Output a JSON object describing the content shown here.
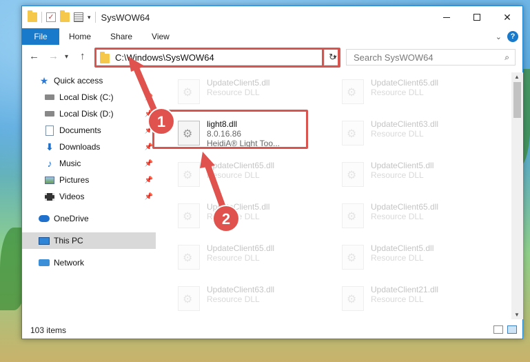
{
  "window": {
    "title": "SysWOW64"
  },
  "ribbon": {
    "tabs": [
      "File",
      "Home",
      "Share",
      "View"
    ]
  },
  "nav": {
    "address": "C:\\Windows\\SysWOW64",
    "search_placeholder": "Search SysWOW64"
  },
  "sidebar": {
    "items": [
      {
        "label": "Quick access",
        "icon": "star-icon"
      },
      {
        "label": "Local Disk (C:)",
        "icon": "disk-icon"
      },
      {
        "label": "Local Disk (D:)",
        "icon": "disk-icon"
      },
      {
        "label": "Documents",
        "icon": "document-icon"
      },
      {
        "label": "Downloads",
        "icon": "download-icon"
      },
      {
        "label": "Music",
        "icon": "music-icon"
      },
      {
        "label": "Pictures",
        "icon": "pictures-icon"
      },
      {
        "label": "Videos",
        "icon": "videos-icon"
      },
      {
        "label": "OneDrive",
        "icon": "cloud-icon"
      },
      {
        "label": "This PC",
        "icon": "computer-icon"
      },
      {
        "label": "Network",
        "icon": "network-icon"
      }
    ]
  },
  "files": {
    "left": [
      {
        "name": "UpdateClient5.dll",
        "sub": "Resource DLL"
      },
      {
        "name": "light8.dll",
        "sub": "8.0.16.86",
        "sub2": "HeidiA® Light Too..."
      },
      {
        "name": "UpdateClient65.dll",
        "sub": "Resource DLL"
      },
      {
        "name": "UpdateClient5.dll",
        "sub": "Resource DLL"
      },
      {
        "name": "UpdateClient65.dll",
        "sub": "Resource DLL"
      },
      {
        "name": "UpdateClient63.dll",
        "sub": "Resource DLL"
      }
    ],
    "right": [
      {
        "name": "UpdateClient65.dll",
        "sub": "Resource DLL"
      },
      {
        "name": "UpdateClient63.dll",
        "sub": "Resource DLL"
      },
      {
        "name": "UpdateClient5.dll",
        "sub": "Resource DLL"
      },
      {
        "name": "UpdateClient65.dll",
        "sub": "Resource DLL"
      },
      {
        "name": "UpdateClient5.dll",
        "sub": "Resource DLL"
      },
      {
        "name": "UpdateClient21.dll",
        "sub": "Resource DLL"
      }
    ]
  },
  "status": {
    "count": "103 items"
  },
  "annotations": {
    "step1": "1",
    "step2": "2"
  },
  "colors": {
    "accent": "#1979ca",
    "highlight": "#d9534f"
  }
}
